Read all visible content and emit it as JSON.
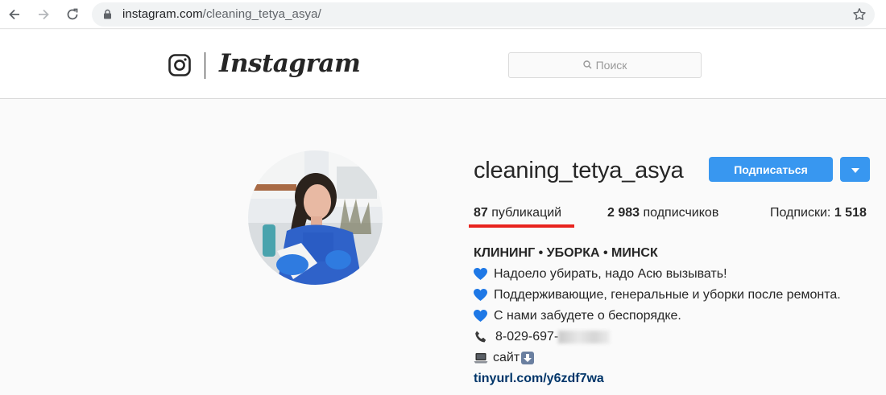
{
  "browser": {
    "url_host": "instagram.com",
    "url_path": "/cleaning_tetya_asya/",
    "icons": [
      "back-arrow-icon",
      "forward-arrow-icon",
      "reload-icon",
      "lock-icon",
      "bookmark-star-icon"
    ]
  },
  "header": {
    "wordmark": "Instagram",
    "search_placeholder": "Поиск",
    "icons": [
      "instagram-camera-icon",
      "search-icon"
    ]
  },
  "profile": {
    "username": "cleaning_tetya_asya",
    "follow_label": "Подписаться",
    "stats": {
      "posts_count": "87",
      "posts_label": "публикаций",
      "followers_count": "2 983",
      "followers_label": "подписчиков",
      "following_label": "Подписки:",
      "following_count": "1 518"
    },
    "bio": {
      "name": "КЛИНИНГ • УБОРКА • МИНСК",
      "line1": "Надоело убирать, надо Асю вызывать!",
      "line2": "Поддерживающие, генеральные и уборки после ремонта.",
      "line3": "С нами забудете о беспорядке.",
      "phone_visible": "8-029-697-",
      "site_label": "сайт",
      "link": "tinyurl.com/y6zdf7wa"
    }
  },
  "colors": {
    "accent": "#3897f0",
    "highlight": "#e8231d",
    "heart": "#1e78e6",
    "link": "#003569",
    "background": "#fafafa"
  }
}
